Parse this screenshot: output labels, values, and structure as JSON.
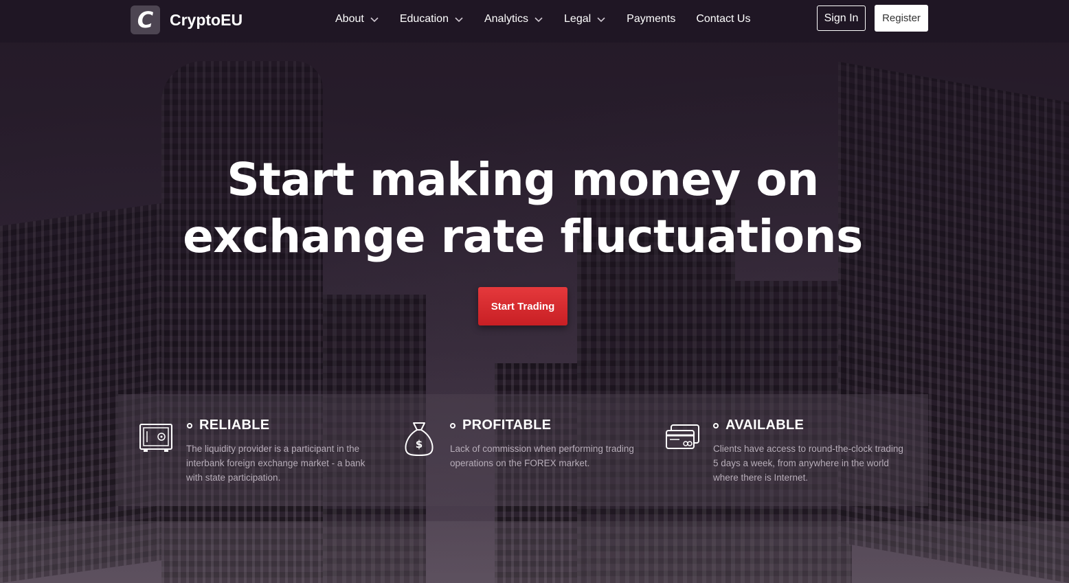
{
  "header": {
    "logo_letter": "C",
    "brand": "CryptoEU",
    "nav": [
      {
        "label": "About",
        "dropdown": true
      },
      {
        "label": "Education",
        "dropdown": true
      },
      {
        "label": "Analytics",
        "dropdown": true
      },
      {
        "label": "Legal",
        "dropdown": true
      },
      {
        "label": "Payments",
        "dropdown": false
      },
      {
        "label": "Contact Us",
        "dropdown": false
      }
    ],
    "sign_in": "Sign In",
    "register": "Register"
  },
  "hero": {
    "title_line1": "Start making money on",
    "title_line2": "exchange rate fluctuations",
    "cta": "Start Trading",
    "cta_color": "#d62b2f"
  },
  "features": [
    {
      "icon": "safe-icon",
      "title": "RELIABLE",
      "desc": "The liquidity provider is a participant in the interbank foreign exchange market - a bank with state participation."
    },
    {
      "icon": "money-bag-icon",
      "title": "PROFITABLE",
      "desc": "Lack of commission when performing trading operations on the FOREX market."
    },
    {
      "icon": "credit-cards-icon",
      "title": "AVAILABLE",
      "desc": "Clients have access to round-the-clock trading 5 days a week, from anywhere in the world where there is Internet."
    }
  ]
}
